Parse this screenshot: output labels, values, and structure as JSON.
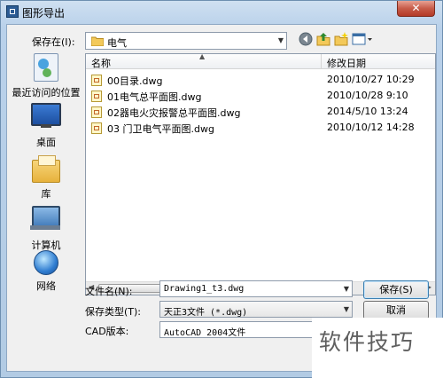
{
  "window": {
    "title": "图形导出",
    "close_glyph": "✕"
  },
  "toolbar": {
    "lookin_label": "保存在(I):",
    "lookin_value": "电气",
    "back_icon": "back-icon",
    "up_icon": "up-folder-icon",
    "new_folder_icon": "new-folder-icon",
    "view_icon": "view-menu-icon"
  },
  "places": [
    {
      "label": "最近访问的位置",
      "icon": "recent-places-icon"
    },
    {
      "label": "桌面",
      "icon": "desktop-icon"
    },
    {
      "label": "库",
      "icon": "libraries-icon"
    },
    {
      "label": "计算机",
      "icon": "computer-icon"
    },
    {
      "label": "网络",
      "icon": "network-icon"
    }
  ],
  "file_list": {
    "columns": {
      "name": "名称",
      "date": "修改日期"
    },
    "rows": [
      {
        "name": "00目录.dwg",
        "date": "2010/10/27 10:29"
      },
      {
        "name": "01电气总平面图.dwg",
        "date": "2010/10/28 9:10"
      },
      {
        "name": "02器电火灾报警总平面图.dwg",
        "date": "2014/5/10 13:24"
      },
      {
        "name": "03 门卫电气平面图.dwg",
        "date": "2010/10/12 14:28"
      }
    ]
  },
  "form": {
    "filename_label": "文件名(N):",
    "filename_value": "Drawing1_t3.dwg",
    "filetype_label": "保存类型(T):",
    "filetype_value": "天正3文件 (*.dwg)",
    "cad_label": "CAD版本:",
    "cad_value": "AutoCAD 2004文件"
  },
  "buttons": {
    "save": "保存(S)",
    "cancel": "取消"
  },
  "watermark": "软件技巧"
}
